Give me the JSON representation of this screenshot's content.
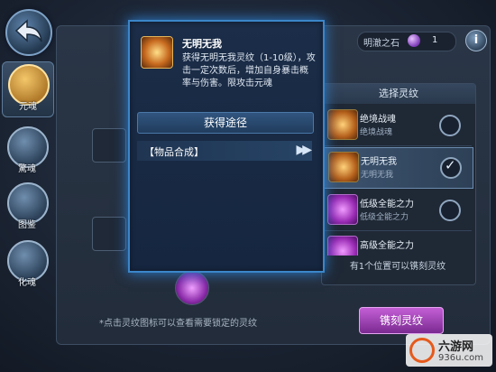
{
  "nav": {
    "items": [
      {
        "label": "元魂",
        "active": true
      },
      {
        "label": "驚魂",
        "active": false
      },
      {
        "label": "图鉴",
        "active": false
      },
      {
        "label": "化魂",
        "active": false
      }
    ]
  },
  "header": {
    "currency_label": "明澈之石",
    "currency_count": "1",
    "info_label": "i"
  },
  "popup": {
    "title": "无明无我",
    "description": "获得无明无我灵纹（1-10级），攻击一定次数后，增加自身暴击概率与伤害。限攻击元魂",
    "section_title": "获得途径",
    "source_label": "【物品合成】",
    "arrow": "▶▶"
  },
  "rune_panel": {
    "header": "选择灵纹",
    "items": [
      {
        "name": "绝境战魂",
        "sub": "绝境战魂",
        "color": "gold",
        "checked": false
      },
      {
        "name": "无明无我",
        "sub": "无明无我",
        "color": "gold",
        "checked": true
      },
      {
        "name": "低级全能之力",
        "sub": "低级全能之力",
        "color": "purple",
        "checked": false
      },
      {
        "name": "高级全能之力",
        "sub": "",
        "color": "purple",
        "checked": false
      }
    ],
    "footer": "有1个位置可以镌刻灵纹"
  },
  "engrave_button": "镌刻灵纹",
  "hint": "*点击灵纹图标可以查看需要锁定的灵纹",
  "watermark": {
    "name": "六游网",
    "url": "936u.com"
  }
}
